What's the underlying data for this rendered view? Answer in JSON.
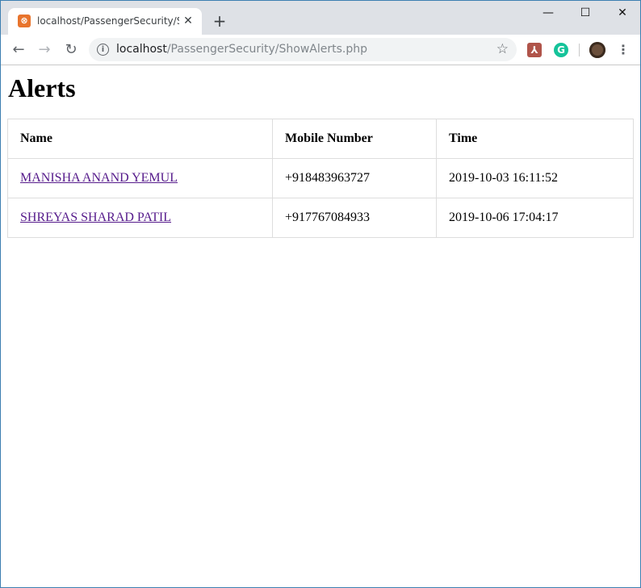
{
  "tab": {
    "title": "localhost/PassengerSecurity/ShowAlerts.php",
    "favicon": "xampp-icon"
  },
  "window_controls": {
    "minimize": "—",
    "maximize": "☐",
    "close": "✕"
  },
  "address_bar": {
    "host": "localhost",
    "path": "/PassengerSecurity/ShowAlerts.php"
  },
  "page": {
    "title": "Alerts",
    "table": {
      "headers": [
        "Name",
        "Mobile Number",
        "Time"
      ],
      "rows": [
        {
          "name": "MANISHA ANAND YEMUL",
          "mobile": "+918483963727",
          "time": "2019-10-03 16:11:52"
        },
        {
          "name": "SHREYAS SHARAD PATIL",
          "mobile": "+917767084933",
          "time": "2019-10-06 17:04:17"
        }
      ]
    }
  },
  "colors": {
    "visited_link": "#551a8b",
    "table_border": "#dddddd",
    "tabstrip": "#dee1e6"
  }
}
